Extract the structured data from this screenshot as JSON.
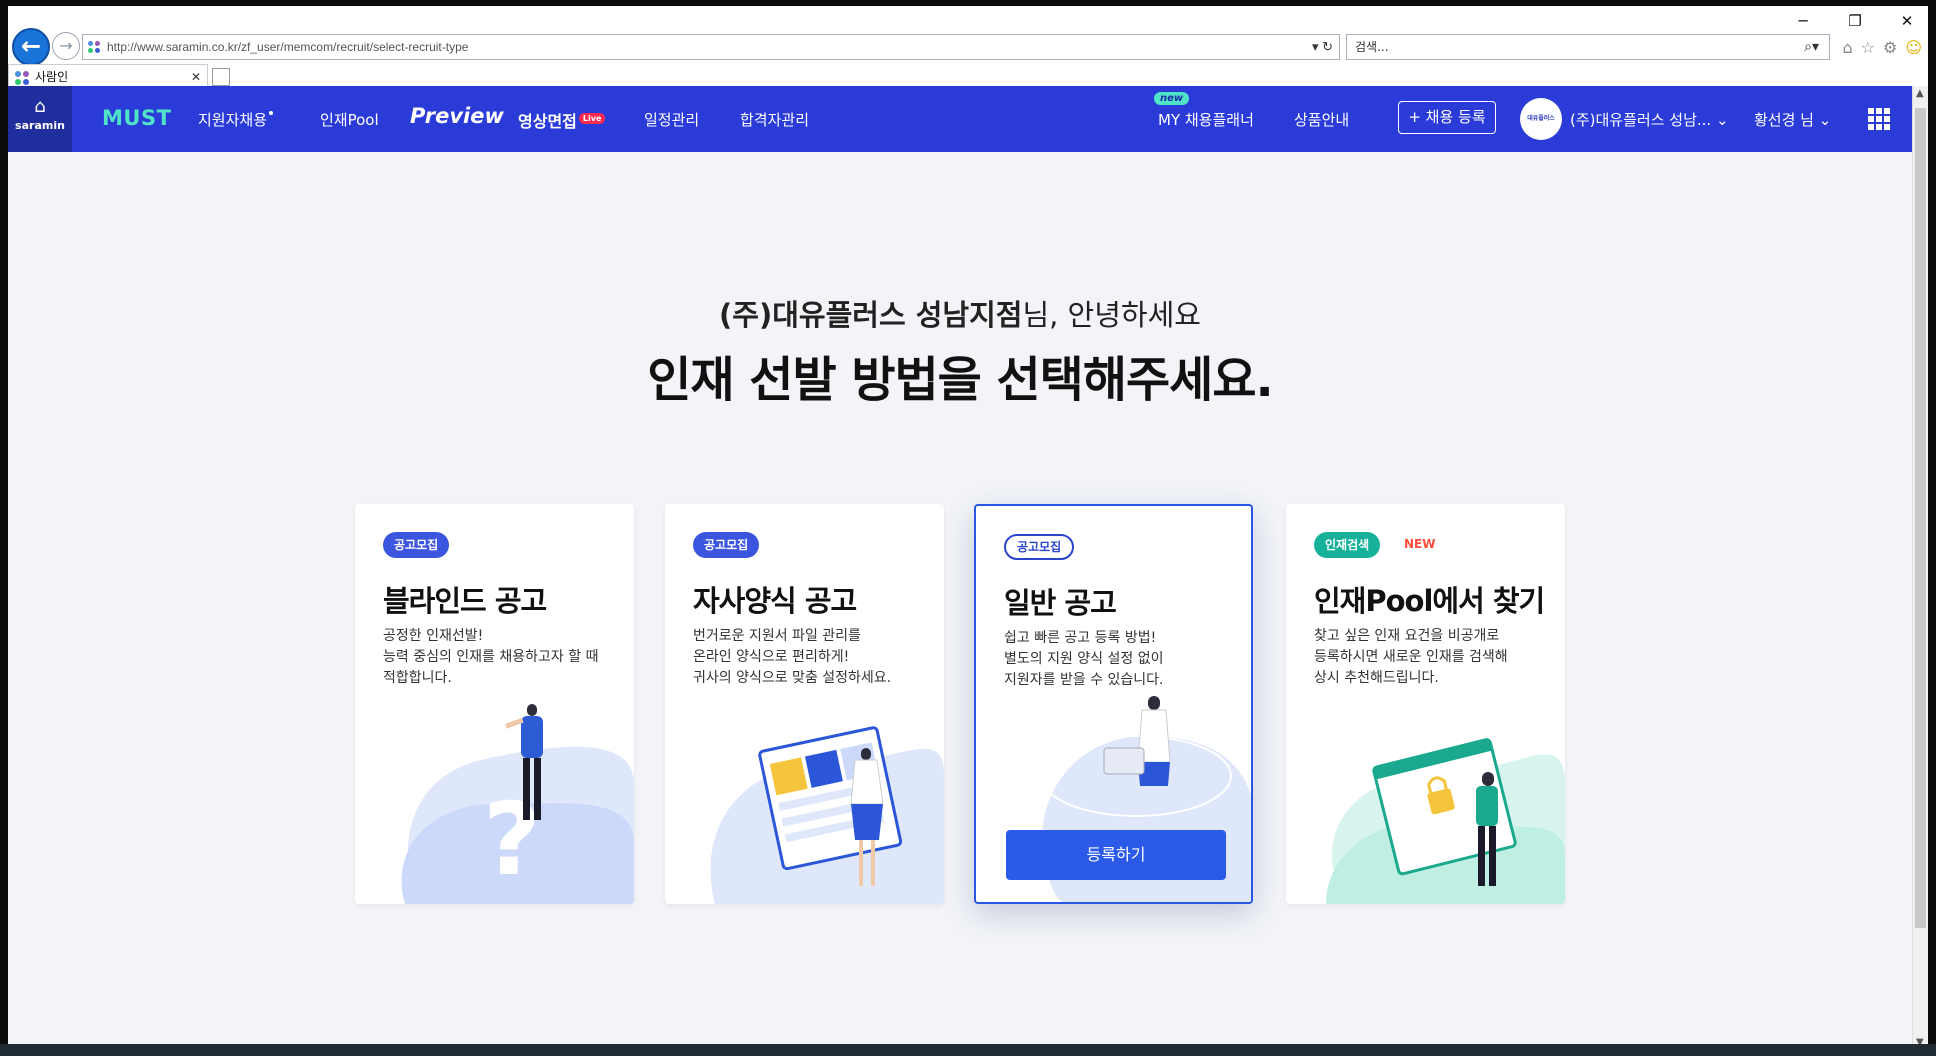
{
  "browser": {
    "url": "http://www.saramin.co.kr/zf_user/memcom/recruit/select-recruit-type",
    "search_placeholder": "검색...",
    "tab_title": "사람인",
    "back_icon": "back-arrow-icon",
    "forward_icon": "forward-arrow-icon"
  },
  "header": {
    "home_label": "saramin",
    "logo": "MUST",
    "menu": [
      "지원자채용",
      "인재Pool",
      "Preview",
      "영상면접",
      "일정관리",
      "합격자관리"
    ],
    "live_badge": "Live",
    "new_badge": "new",
    "planner": "MY 채용플래너",
    "products": "상품안내",
    "register": "+ 채용 등록",
    "avatar_text": "대유플러스",
    "company": "(주)대유플러스 성남...",
    "user": "황선경 님",
    "colors": {
      "bar": "#2a3bd8",
      "accent": "#4fe3c8"
    }
  },
  "main": {
    "greeting_company": "(주)대유플러스 성남지점",
    "greeting_suffix": "님, 안녕하세요",
    "headline": "인재 선발 방법을 선택해주세요.",
    "cards": [
      {
        "badge": "공고모집",
        "title": "블라인드 공고",
        "desc": [
          "공정한 인재선발!",
          "능력 중심의 인재를 채용하고자 할 때",
          "적합합니다."
        ]
      },
      {
        "badge": "공고모집",
        "title": "자사양식 공고",
        "desc": [
          "번거로운 지원서 파일 관리를",
          "온라인 양식으로 편리하게!",
          "귀사의 양식으로 맞춤 설정하세요."
        ]
      },
      {
        "badge": "공고모집",
        "title": "일반 공고",
        "desc": [
          "쉽고 빠른 공고 등록 방법!",
          "별도의 지원 양식 설정 없이",
          "지원자를 받을 수 있습니다."
        ],
        "button": "등록하기"
      },
      {
        "badge": "인재검색",
        "new": "NEW",
        "title": "인재Pool에서 찾기",
        "desc": [
          "찾고 싶은 인재 요건을 비공개로",
          "등록하시면 새로운 인재를 검색해",
          "상시 추천해드립니다."
        ]
      }
    ]
  }
}
